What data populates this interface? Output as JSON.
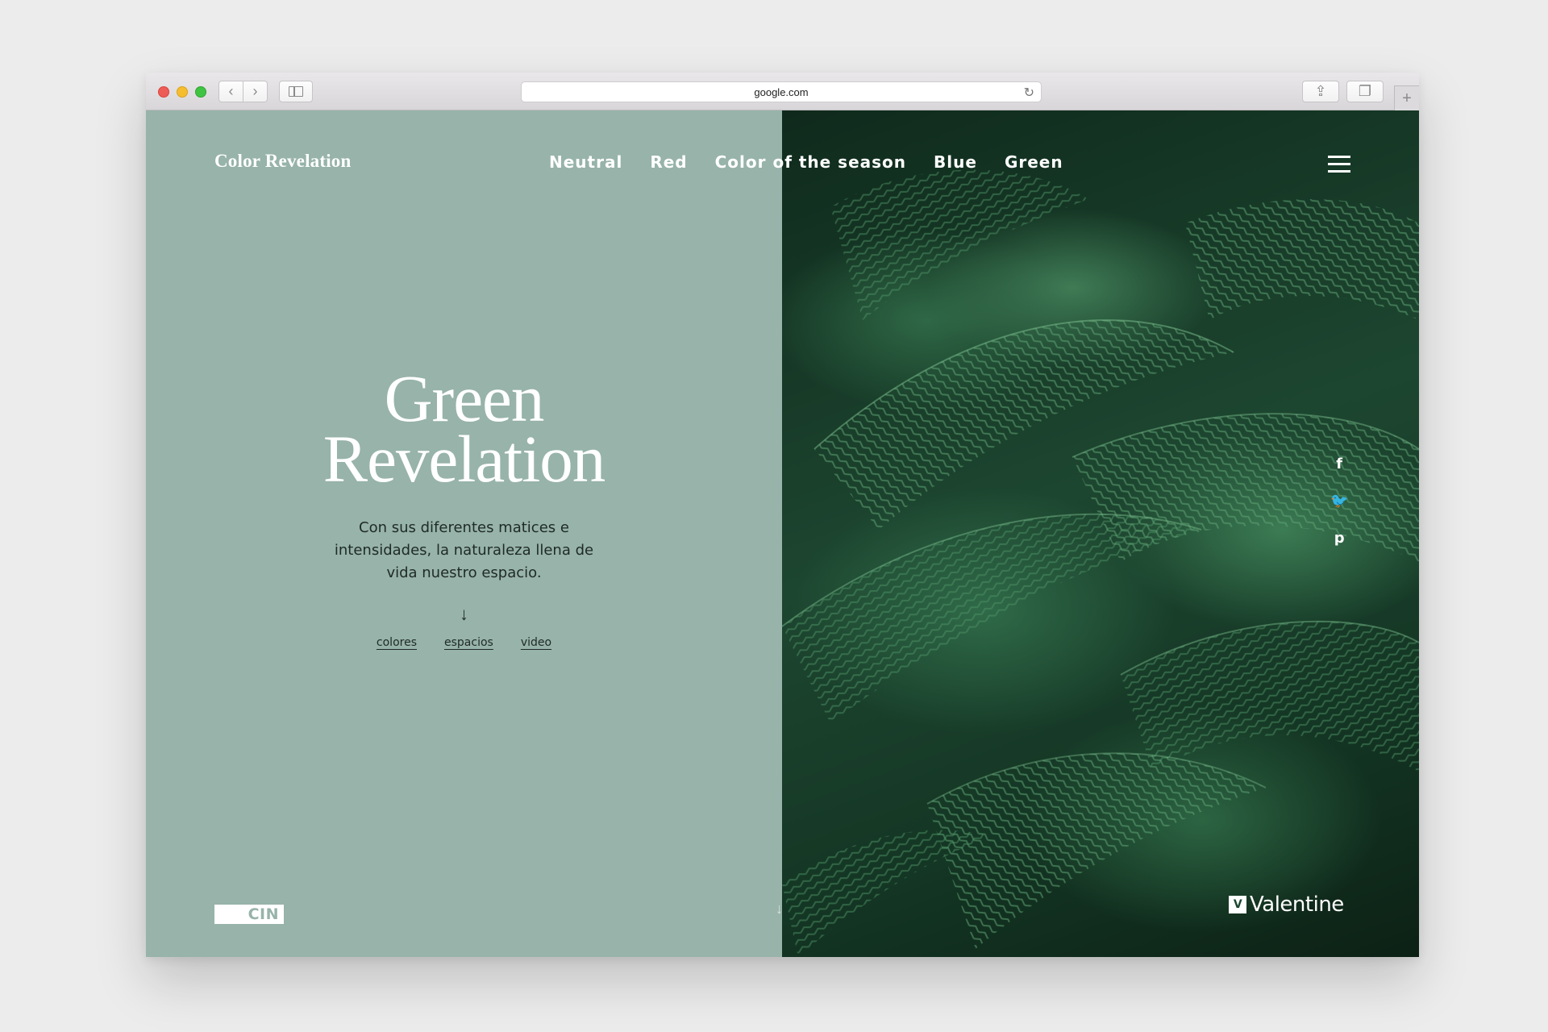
{
  "browser": {
    "url": "google.com",
    "back_glyph": "‹",
    "forward_glyph": "›",
    "reload_glyph": "↻",
    "share_glyph": "⇪",
    "tabs_glyph": "❐",
    "newtab_glyph": "+"
  },
  "site": {
    "brand": "Color Revelation",
    "nav": [
      "Neutral",
      "Red",
      "Color of the season",
      "Blue",
      "Green"
    ],
    "hero": {
      "title_line1": "Green",
      "title_line2": "Revelation",
      "text": "Con sus diferentes matices e intensidades, la naturaleza llena de vida nuestro espacio.",
      "arrow": "↓"
    },
    "sublinks": [
      "colores",
      "espacios",
      "video"
    ],
    "cin_logo": "CIN",
    "scroll_arrow": "↓",
    "social": {
      "facebook": "f",
      "twitter": "🐦",
      "pinterest": "p"
    },
    "partner": "Valentine",
    "partner_mark": "V"
  },
  "colors": {
    "left_pane": "#97b3aa",
    "fern_dark": "#0f2a1c",
    "fern_light": "#3c7c54"
  }
}
